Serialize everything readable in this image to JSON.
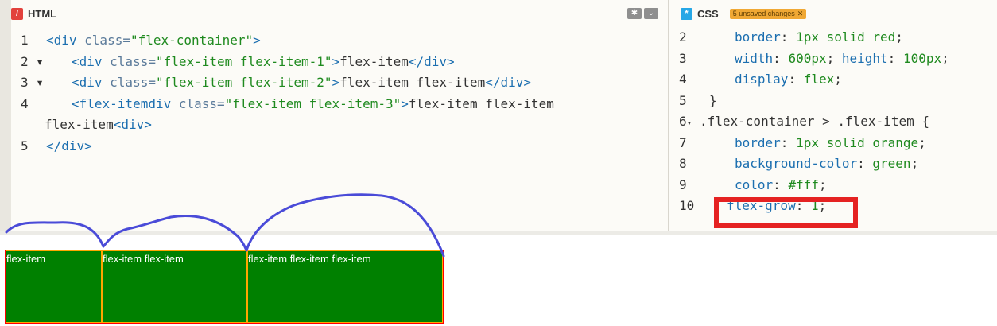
{
  "html_panel": {
    "tab_label": "HTML",
    "badge": "/",
    "lines": [
      {
        "num": "1",
        "arrow": ""
      },
      {
        "num": "2",
        "arrow": "▾"
      },
      {
        "num": "3",
        "arrow": "▾"
      },
      {
        "num": "4",
        "arrow": ""
      },
      {
        "num": "",
        "arrow": ""
      },
      {
        "num": "5",
        "arrow": ""
      }
    ],
    "code": {
      "l1": {
        "open": "<div",
        "attr": " class=",
        "val": "\"flex-container\"",
        "close": ">"
      },
      "l2": {
        "open": "<div",
        "attr": " class=",
        "val": "\"flex-item flex-item-1\"",
        "close": ">",
        "text": "flex-item",
        "end": "</div>"
      },
      "l3": {
        "open": "<div",
        "attr": " class=",
        "val": "\"flex-item flex-item-2\"",
        "close": ">",
        "text": "flex-item flex-item",
        "end": "</div>"
      },
      "l4": {
        "open": "<flex-itemdiv",
        "attr": " class=",
        "val": "\"flex-item flex-item-3\"",
        "close": ">",
        "text": "flex-item flex-item"
      },
      "l4b": {
        "text": "flex-item",
        "end": "<div>"
      },
      "l5": {
        "end": "</div>"
      }
    }
  },
  "css_panel": {
    "tab_label": "CSS",
    "badge": "*",
    "unsaved_label": "5 unsaved changes",
    "unsaved_close": "✕",
    "lines": [
      {
        "num": "2",
        "arrow": "",
        "prop": "border",
        "val": "1px solid red"
      },
      {
        "num": "3",
        "arrow": "",
        "prop": "width",
        "val": "600px",
        "prop2": "height",
        "val2": "100px"
      },
      {
        "num": "4",
        "arrow": "",
        "prop": "display",
        "val": "flex"
      },
      {
        "num": "5",
        "arrow": "",
        "brace": "}"
      },
      {
        "num": "6",
        "arrow": "▾",
        "selector": ".flex-container > .flex-item {"
      },
      {
        "num": "7",
        "arrow": "",
        "prop": "border",
        "val": "1px solid orange"
      },
      {
        "num": "8",
        "arrow": "",
        "prop": "background-color",
        "val": "green"
      },
      {
        "num": "9",
        "arrow": "",
        "prop": "color",
        "val": "#fff"
      },
      {
        "num": "10",
        "arrow": "",
        "prop": "flex-grow",
        "val": "1"
      }
    ]
  },
  "toolbar": {
    "settings_icon": "gear-icon",
    "collapse_icon": "chevron-down-icon",
    "settings_glyph": "✱",
    "collapse_glyph": "⌄"
  },
  "preview": {
    "items": [
      "flex-item",
      "flex-item flex-item",
      "flex-item flex-item flex-item"
    ]
  },
  "colors": {
    "annotation_box": "#e52222",
    "scribble": "#4a4bd8",
    "item_bg": "#008000",
    "item_border": "#ffa500",
    "container_border": "#ff0000"
  }
}
